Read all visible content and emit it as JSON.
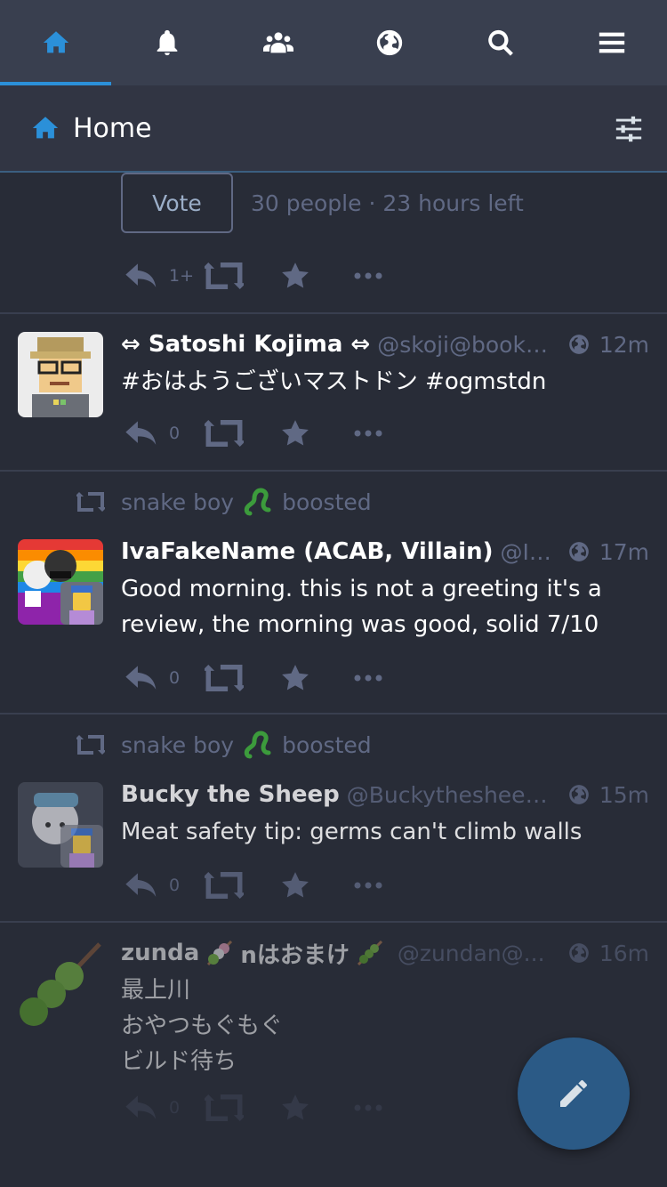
{
  "tabbar": {
    "tabs": [
      {
        "icon": "home-icon",
        "active": true
      },
      {
        "icon": "bell-icon",
        "active": false
      },
      {
        "icon": "users-icon",
        "active": false
      },
      {
        "icon": "globe-icon",
        "active": false
      },
      {
        "icon": "search-icon",
        "active": false
      },
      {
        "icon": "menu-icon",
        "active": false
      }
    ],
    "accent": "#2b90d9"
  },
  "column": {
    "title": "Home",
    "icon": "home-icon",
    "settings_icon": "sliders-icon"
  },
  "poll": {
    "vote_label": "Vote",
    "meta": "30 people · 23 hours left",
    "reply_count": "1+"
  },
  "statuses": [
    {
      "display_name": "⇔ Satoshi Kojima ⇔",
      "acct": "@skoji@bookw...",
      "time": "12m",
      "content": "#おはようございマストドン #ogmstdn",
      "reply_count": "0"
    },
    {
      "boosted_by": "snake boy",
      "boosted_label": "boosted",
      "display_name": "IvaFakeName (ACAB, Villain)",
      "acct": "@Ivaf...",
      "time": "17m",
      "content": "Good morning. this is not a greeting it's a review, the morning was good, solid 7/10",
      "reply_count": "0"
    },
    {
      "boosted_by": "snake boy",
      "boosted_label": "boosted",
      "display_name": "Bucky the Sheep",
      "acct": "@Buckythesheep@...",
      "time": "15m",
      "content": "Meat safety tip: germs can't climb walls",
      "reply_count": "0"
    },
    {
      "display_name_a": "zunda",
      "display_name_b": "nはおまけ",
      "acct": "@zundan@...",
      "time": "16m",
      "content_lines": [
        "最上川",
        "おやつもぐもぐ",
        "ビルド待ち"
      ],
      "reply_count": "0"
    }
  ],
  "fab": {
    "icon": "pencil-icon"
  },
  "colors": {
    "background": "#282c37",
    "tabbar": "#393f4f",
    "muted": "#606984"
  }
}
